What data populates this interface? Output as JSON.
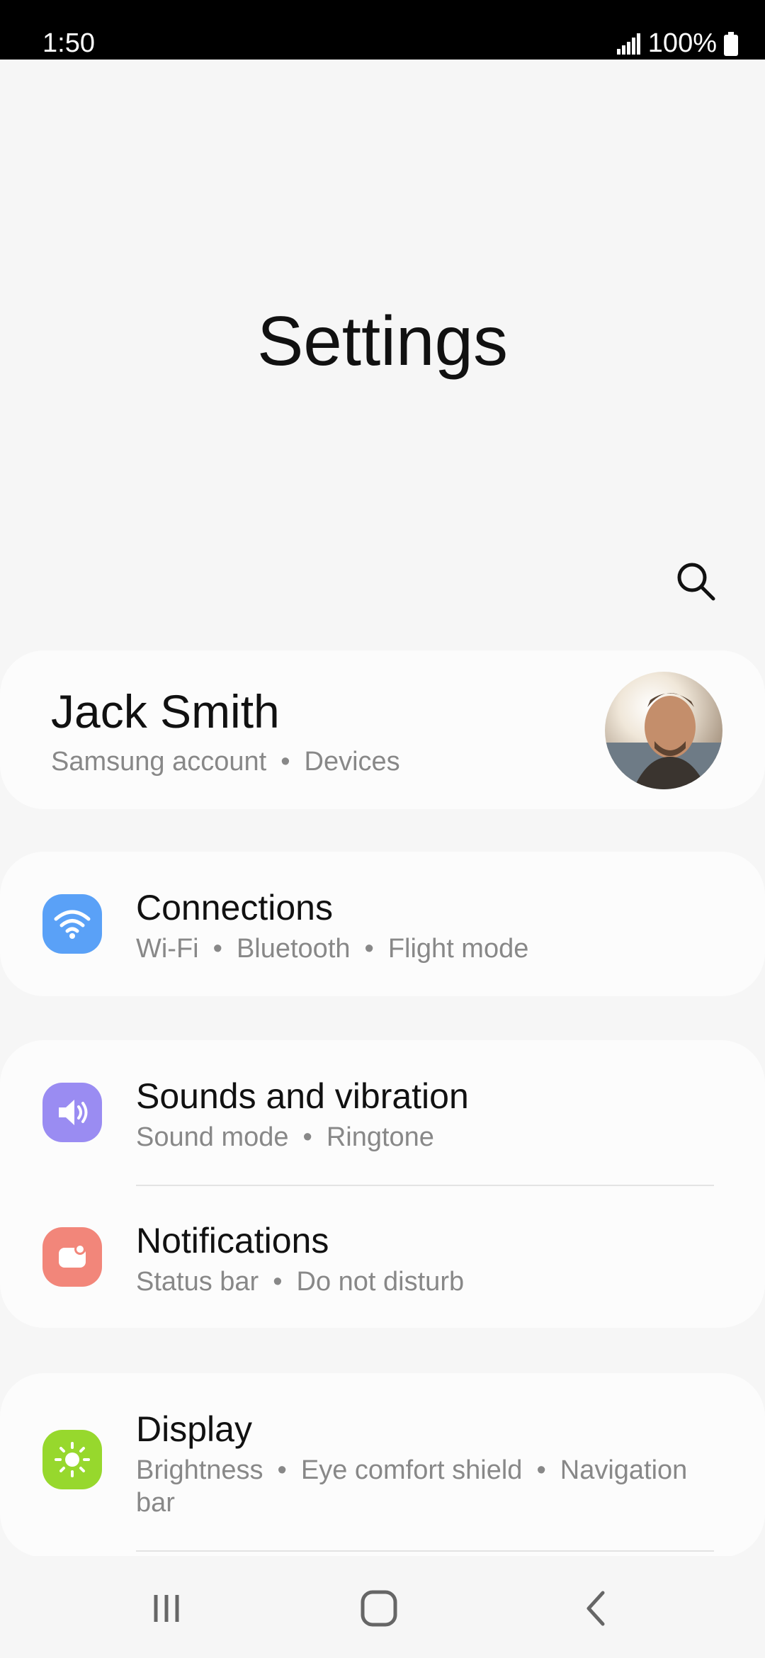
{
  "status_bar": {
    "time": "1:50",
    "battery": "100%"
  },
  "page_title": "Settings",
  "account": {
    "name": "Jack Smith",
    "sub1": "Samsung account",
    "sub2": "Devices"
  },
  "groups": [
    {
      "items": [
        {
          "title": "Connections",
          "sub": [
            "Wi-Fi",
            "Bluetooth",
            "Flight mode"
          ],
          "icon": "wifi-icon",
          "color": "#5aa1f7"
        }
      ]
    },
    {
      "items": [
        {
          "title": "Sounds and vibration",
          "sub": [
            "Sound mode",
            "Ringtone"
          ],
          "icon": "speaker-icon",
          "color": "#9a8cf2"
        },
        {
          "title": "Notifications",
          "sub": [
            "Status bar",
            "Do not disturb"
          ],
          "icon": "notification-icon",
          "color": "#f2867a"
        }
      ]
    },
    {
      "items": [
        {
          "title": "Display",
          "sub": [
            "Brightness",
            "Eye comfort shield",
            "Navigation bar"
          ],
          "icon": "sun-icon",
          "color": "#97d82d"
        }
      ]
    }
  ]
}
